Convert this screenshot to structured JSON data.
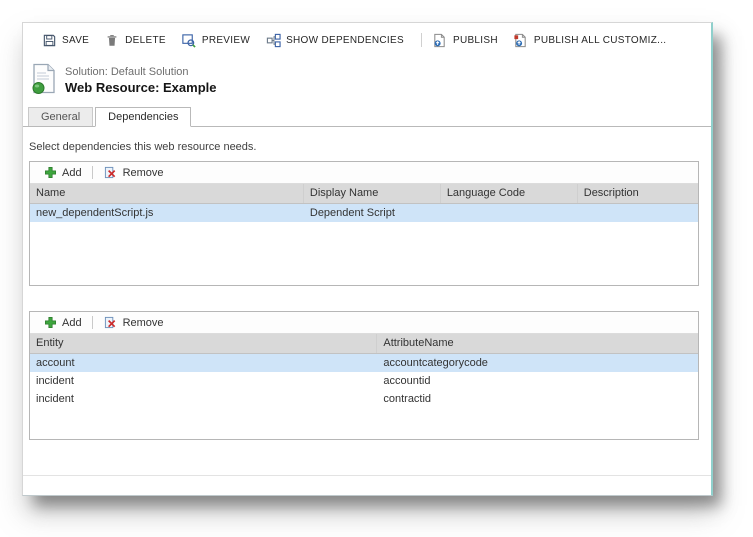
{
  "header": {
    "solution_label": "Solution: Default Solution",
    "title": "Web Resource: Example"
  },
  "command_bar": {
    "items": [
      {
        "label": "SAVE",
        "icon": "save-icon"
      },
      {
        "label": "DELETE",
        "icon": "delete-icon"
      },
      {
        "label": "PREVIEW",
        "icon": "preview-icon"
      },
      {
        "label": "SHOW DEPENDENCIES",
        "icon": "show-dependencies-icon"
      },
      {
        "label": "PUBLISH",
        "icon": "publish-icon"
      },
      {
        "label": "PUBLISH ALL CUSTOMIZ...",
        "icon": "publish-all-icon"
      }
    ]
  },
  "tabs": [
    {
      "label": "General",
      "active": false
    },
    {
      "label": "Dependencies",
      "active": true
    }
  ],
  "content": {
    "instruction": "Select dependencies this web resource needs.",
    "grids": [
      {
        "toolbar": {
          "add_label": "Add",
          "remove_label": "Remove"
        },
        "columns": [
          "Name",
          "Display Name",
          "Language Code",
          "Description"
        ],
        "col_widths": [
          "41%",
          "20.5%",
          "20.5%",
          "18%"
        ],
        "rows": [
          {
            "cells": [
              "new_dependentScript.js",
              "Dependent Script",
              "",
              ""
            ],
            "selected": true
          }
        ]
      },
      {
        "toolbar": {
          "add_label": "Add",
          "remove_label": "Remove"
        },
        "columns": [
          "Entity",
          "AttributeName"
        ],
        "col_widths": [
          "52%",
          "48%"
        ],
        "rows": [
          {
            "cells": [
              "account",
              "accountcategorycode"
            ],
            "selected": true
          },
          {
            "cells": [
              "incident",
              "accountid"
            ],
            "selected": false
          },
          {
            "cells": [
              "incident",
              "contractid"
            ],
            "selected": false
          }
        ]
      }
    ]
  },
  "colors": {
    "selected_row_bg": "#cfe4f8",
    "header_bg": "#d9d9d9",
    "accent_teal": "#8fd0cc",
    "add_green": "#3da53d",
    "remove_red": "#cc2b2b",
    "icon_blue": "#3a62a7"
  }
}
